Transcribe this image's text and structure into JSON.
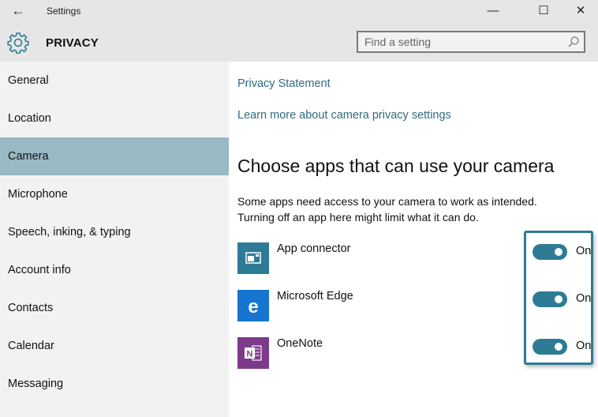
{
  "window": {
    "title": "Settings",
    "back_icon": "arrow-left-icon",
    "controls": {
      "minimize": "—",
      "maximize": "☐",
      "close": "✕"
    }
  },
  "header": {
    "section_icon": "gear-icon",
    "section_title": "PRIVACY",
    "search": {
      "placeholder": "Find a setting",
      "value": "",
      "icon": "search-icon"
    }
  },
  "sidebar": {
    "items": [
      {
        "label": "General",
        "active": false
      },
      {
        "label": "Location",
        "active": false
      },
      {
        "label": "Camera",
        "active": true
      },
      {
        "label": "Microphone",
        "active": false
      },
      {
        "label": "Speech, inking, & typing",
        "active": false
      },
      {
        "label": "Account info",
        "active": false
      },
      {
        "label": "Contacts",
        "active": false
      },
      {
        "label": "Calendar",
        "active": false
      },
      {
        "label": "Messaging",
        "active": false
      }
    ]
  },
  "main": {
    "links": {
      "privacy_statement": "Privacy Statement",
      "learn_more": "Learn more about camera privacy settings"
    },
    "heading": "Choose apps that can use your camera",
    "description_line1": "Some apps need access to your camera to work as intended.",
    "description_line2": "Turning off an app here might limit what it can do.",
    "apps": [
      {
        "name": "App connector",
        "icon": "app-connector-icon",
        "icon_color": "#2e7b96",
        "state": "On",
        "enabled": true
      },
      {
        "name": "Microsoft Edge",
        "icon": "edge-icon",
        "icon_color": "#1575d0",
        "state": "On",
        "enabled": true
      },
      {
        "name": "OneNote",
        "icon": "onenote-icon",
        "icon_color": "#7d3a8a",
        "state": "On",
        "enabled": true
      }
    ]
  },
  "colors": {
    "accent": "#2e7b96",
    "active_nav": "#99b9c5",
    "link": "#2f6b80"
  }
}
